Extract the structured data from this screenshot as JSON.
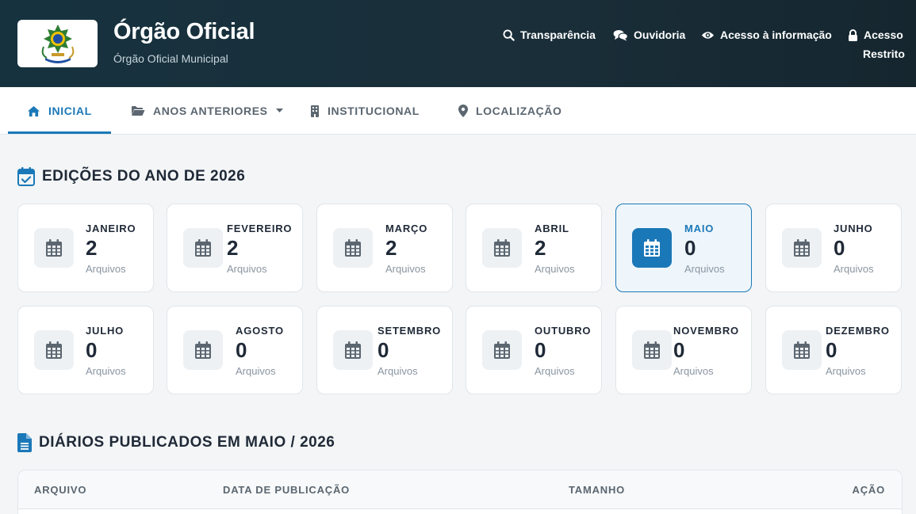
{
  "header": {
    "title": "Órgão Oficial",
    "subtitle": "Órgão Oficial Municipal",
    "links": {
      "transparencia": "Transparência",
      "ouvidoria": "Ouvidoria",
      "acesso_info": "Acesso à informação",
      "acesso_restrito_line1": "Acesso",
      "acesso_restrito_line2": "Restrito"
    }
  },
  "nav": {
    "inicial": "INICIAL",
    "anos_anteriores": "ANOS ANTERIORES",
    "institucional": "INSTITUCIONAL",
    "localizacao": "LOCALIZAÇÃO"
  },
  "editions": {
    "title": "EDIÇÕES DO ANO DE 2026",
    "unit_label": "Arquivos",
    "months": [
      {
        "name": "JANEIRO",
        "count": "2"
      },
      {
        "name": "FEVEREIRO",
        "count": "2"
      },
      {
        "name": "MARÇO",
        "count": "2"
      },
      {
        "name": "ABRIL",
        "count": "2"
      },
      {
        "name": "MAIO",
        "count": "0"
      },
      {
        "name": "JUNHO",
        "count": "0"
      },
      {
        "name": "JULHO",
        "count": "0"
      },
      {
        "name": "AGOSTO",
        "count": "0"
      },
      {
        "name": "SETEMBRO",
        "count": "0"
      },
      {
        "name": "OUTUBRO",
        "count": "0"
      },
      {
        "name": "NOVEMBRO",
        "count": "0"
      },
      {
        "name": "DEZEMBRO",
        "count": "0"
      }
    ]
  },
  "diarios": {
    "title": "DIÁRIOS PUBLICADOS EM MAIO / 2026",
    "columns": {
      "arquivo": "ARQUIVO",
      "data": "DATA DE PUBLICAÇÃO",
      "tamanho": "TAMANHO",
      "acao": "AÇÃO"
    }
  },
  "colors": {
    "accent": "#1b78b8",
    "header_bg": "#16323f",
    "page_bg": "#f3f5f6"
  }
}
